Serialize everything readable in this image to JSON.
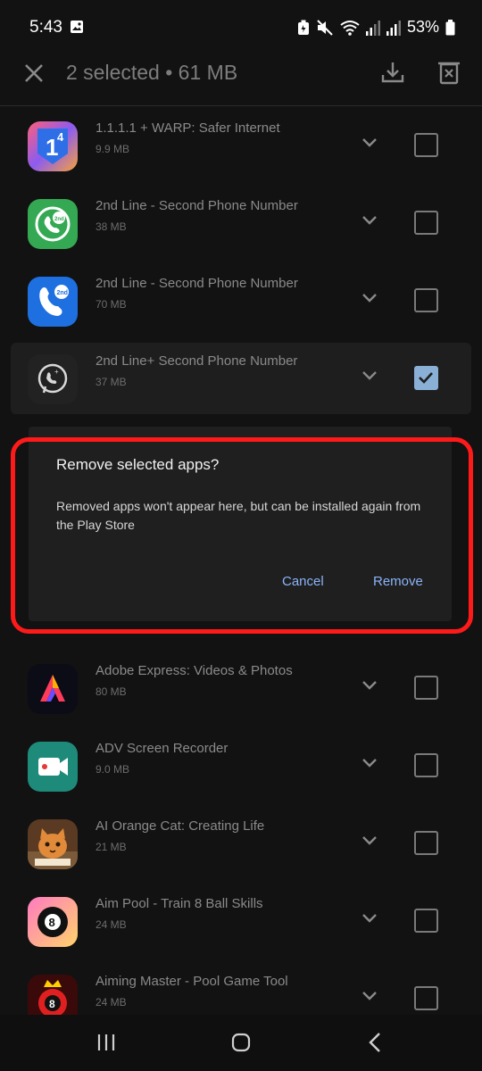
{
  "status_bar": {
    "time": "5:43",
    "battery": "53%"
  },
  "app_bar": {
    "selection": "2 selected • 61 MB"
  },
  "apps": [
    {
      "name": "1.1.1.1 + WARP: Safer Internet",
      "size": "9.9 MB",
      "checked": false
    },
    {
      "name": "2nd Line - Second Phone Number",
      "size": "38 MB",
      "checked": false
    },
    {
      "name": "2nd Line - Second Phone Number",
      "size": "70 MB",
      "checked": false
    },
    {
      "name": "2nd Line+ Second Phone Number",
      "size": "37 MB",
      "checked": true
    },
    {
      "name": "Adobe Express: Videos & Photos",
      "size": "80 MB",
      "checked": false
    },
    {
      "name": "ADV Screen Recorder",
      "size": "9.0 MB",
      "checked": false
    },
    {
      "name": "AI Orange Cat: Creating Life",
      "size": "21 MB",
      "checked": false
    },
    {
      "name": "Aim Pool - Train 8 Ball Skills",
      "size": "24 MB",
      "checked": false
    },
    {
      "name": "Aiming Master - Pool Game Tool",
      "size": "24 MB",
      "checked": false
    }
  ],
  "dialog": {
    "title": "Remove selected apps?",
    "message": "Removed apps won't appear here, but can be installed again from the Play Store",
    "cancel_label": "Cancel",
    "remove_label": "Remove"
  },
  "colors": {
    "background": "#121212",
    "dialog_background": "#1f1f1f",
    "accent": "#8ab4f8",
    "highlight_frame": "#ff1a1a"
  },
  "icons": [
    "image-icon",
    "battery-saver-icon",
    "mute-icon",
    "wifi-icon",
    "signal-icon",
    "battery-icon",
    "close-icon",
    "download-icon",
    "delete-icon",
    "chevron-down-icon",
    "checkbox",
    "recents-icon",
    "home-icon",
    "back-icon"
  ]
}
